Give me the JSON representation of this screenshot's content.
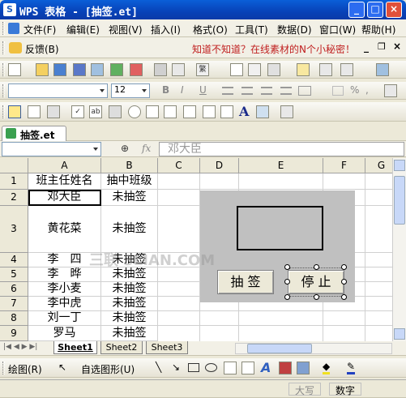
{
  "window": {
    "title": "WPS 表格 - [抽签.et]",
    "app_icon": "S"
  },
  "menu": [
    "文件(F)",
    "编辑(E)",
    "视图(V)",
    "插入(I)",
    "格式(O)",
    "工具(T)",
    "数据(D)",
    "窗口(W)",
    "帮助(H)"
  ],
  "feedback": {
    "label": "反馈(B)",
    "promo": "知道不知道？在线素材的N个小秘密！"
  },
  "format": {
    "font_size": "12"
  },
  "formula": {
    "name_box": "",
    "fx": "fx",
    "content": "邓大臣"
  },
  "columns": [
    "A",
    "B",
    "C",
    "D",
    "E",
    "F",
    "G"
  ],
  "rows": [
    {
      "num": "1",
      "a": "班主任姓名",
      "b": "抽中班级"
    },
    {
      "num": "2",
      "a": "邓大臣",
      "b": "未抽签"
    },
    {
      "num": "3",
      "a": "黄花菜",
      "b": "未抽签"
    },
    {
      "num": "4",
      "a": "李　四",
      "b": "未抽签"
    },
    {
      "num": "5",
      "a": "李　晔",
      "b": "未抽签"
    },
    {
      "num": "6",
      "a": "李小麦",
      "b": "未抽签"
    },
    {
      "num": "7",
      "a": "李中虎",
      "b": "未抽签"
    },
    {
      "num": "8",
      "a": "刘一丁",
      "b": "未抽签"
    },
    {
      "num": "9",
      "a": "罗马",
      "b": "未抽签"
    }
  ],
  "buttons": {
    "draw": "抽 签",
    "stop": "停 止"
  },
  "sheets": [
    "Sheet1",
    "Sheet2",
    "Sheet3"
  ],
  "drawbar": {
    "draw": "绘图(R)",
    "autoshapes": "自选图形(U)"
  },
  "status": {
    "caps": "大写",
    "num": "数字"
  },
  "watermark": "三联 3LIAN.COM"
}
